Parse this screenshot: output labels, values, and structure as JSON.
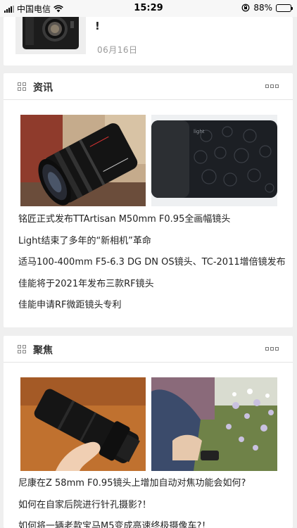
{
  "status_bar": {
    "carrier": "中国电信",
    "time": "15:29",
    "battery": "88%"
  },
  "top_card": {
    "title_fragment": "!",
    "date": "06月16日"
  },
  "sections": [
    {
      "title": "资讯",
      "images": [
        {
          "icon": "camera-lens-photo"
        },
        {
          "icon": "light-camera-photo",
          "caption": "light"
        }
      ],
      "items": [
        "铭匠正式发布TTArtisan M50mm F0.95全画幅镜头",
        "Light结束了多年的“新相机”革命",
        "适马100-400mm F5-6.3 DG DN OS镜头、TC-2011增倍镜发布",
        "佳能将于2021年发布三款RF镜头",
        "佳能申请RF微距镜头专利"
      ]
    },
    {
      "title": "聚焦",
      "images": [
        {
          "icon": "lens-in-hand-photo"
        },
        {
          "icon": "garden-flowers-photo"
        }
      ],
      "items": [
        "尼康在Z 58mm F0.95镜头上增加自动对焦功能会如何?",
        "如何在自家后院进行针孔摄影?！",
        "如何将一辆老款宝马M5变成高速终极摄像车?！"
      ]
    }
  ],
  "colors": {
    "background": "#efefef",
    "card": "#ffffff",
    "date": "#999999",
    "divider": "#e4e4e4"
  }
}
